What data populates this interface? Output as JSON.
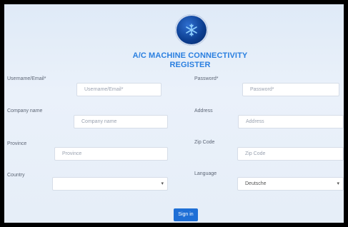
{
  "form": {
    "title_line1": "A/C MACHINE CONNECTIVITY",
    "title_line2": "REGISTER",
    "fields": {
      "username": {
        "label": "Username/Email*",
        "placeholder": "Username/Email*"
      },
      "password": {
        "label": "Password*",
        "placeholder": "Password*"
      },
      "company": {
        "label": "Company name",
        "placeholder": "Company name"
      },
      "address": {
        "label": "Address",
        "placeholder": "Address"
      },
      "province": {
        "label": "Province",
        "placeholder": "Province"
      },
      "zipcode": {
        "label": "Zip Code",
        "placeholder": "Zip Code"
      },
      "country": {
        "label": "Country",
        "value": ""
      },
      "language": {
        "label": "Language",
        "value": "Deutsche"
      }
    },
    "submit_label": "Sign in"
  },
  "icons": {
    "logo": "snowflake-icon",
    "caret": "chevron-down-icon"
  },
  "colors": {
    "accent": "#2a7fe0",
    "button": "#1f6fd6",
    "logo": "#0b3d8f"
  }
}
